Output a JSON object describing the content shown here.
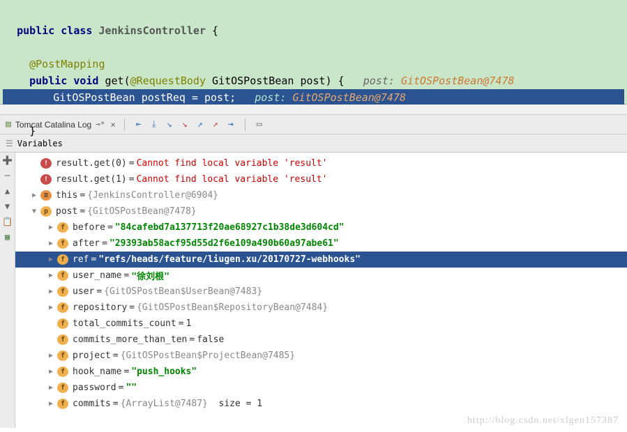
{
  "code": {
    "l1_kw": "public class",
    "l1_name": "JenkinsController",
    "l1_brace": "{",
    "l2_anno": "@PostMapping",
    "l3_kw": "public void",
    "l3_method": "get",
    "l3_anno": "@RequestBody",
    "l3_type": "GitOSPostBean",
    "l3_param": "post",
    "l3_brace": ") {",
    "l3_hint_label": "post:",
    "l3_hint_val": "GitOSPostBean@7478",
    "l4_type": "GitOSPostBean",
    "l4_var": "postReq",
    "l4_eq": "= post;",
    "l4_hint_label": "post:",
    "l4_hint_val": "GitOSPostBean@7478",
    "l5_brace": "}"
  },
  "tabs": {
    "tomcat": "Tomcat Catalina Log"
  },
  "panel_header": "Variables",
  "vars": [
    {
      "icon": "err",
      "name": "result.get(0)",
      "val": "Cannot find local variable 'result'",
      "klass": "v-err-val",
      "lvl": 1,
      "arrow": ""
    },
    {
      "icon": "err",
      "name": "result.get(1)",
      "val": "Cannot find local variable 'result'",
      "klass": "v-err-val",
      "lvl": 1,
      "arrow": ""
    },
    {
      "icon": "obj",
      "name": "this",
      "val": "{JenkinsController@6904}",
      "klass": "v-obj-val",
      "lvl": 1,
      "arrow": "collapsed"
    },
    {
      "icon": "p",
      "name": "post",
      "val": "{GitOSPostBean@7478}",
      "klass": "v-obj-val",
      "lvl": 1,
      "arrow": "expanded"
    },
    {
      "icon": "fld",
      "name": "before",
      "val": "\"84cafebd7a137713f20ae68927c1b38de3d604cd\"",
      "klass": "v-str-val",
      "lvl": 2,
      "arrow": "collapsed"
    },
    {
      "icon": "fld",
      "name": "after",
      "val": "\"29393ab58acf95d55d2f6e109a490b60a97abe61\"",
      "klass": "v-str-val",
      "lvl": 2,
      "arrow": "collapsed"
    },
    {
      "icon": "fld",
      "name": "ref",
      "val": "\"refs/heads/feature/liugen.xu/20170727-webhooks\"",
      "klass": "v-str-val",
      "lvl": 2,
      "arrow": "collapsed",
      "sel": true
    },
    {
      "icon": "fld",
      "name": "user_name",
      "val": "\"徐刘根\"",
      "klass": "v-str-val",
      "lvl": 2,
      "arrow": "collapsed"
    },
    {
      "icon": "fld",
      "name": "user",
      "val": "{GitOSPostBean$UserBean@7483}",
      "klass": "v-obj-val",
      "lvl": 2,
      "arrow": "collapsed"
    },
    {
      "icon": "fld",
      "name": "repository",
      "val": "{GitOSPostBean$RepositoryBean@7484}",
      "klass": "v-obj-val",
      "lvl": 2,
      "arrow": "collapsed"
    },
    {
      "icon": "fld",
      "name": "total_commits_count",
      "val": "1",
      "klass": "v-plain",
      "lvl": 2,
      "arrow": ""
    },
    {
      "icon": "fld",
      "name": "commits_more_than_ten",
      "val": "false",
      "klass": "v-plain",
      "lvl": 2,
      "arrow": ""
    },
    {
      "icon": "fld",
      "name": "project",
      "val": "{GitOSPostBean$ProjectBean@7485}",
      "klass": "v-obj-val",
      "lvl": 2,
      "arrow": "collapsed"
    },
    {
      "icon": "fld",
      "name": "hook_name",
      "val": "\"push_hooks\"",
      "klass": "v-str-val",
      "lvl": 2,
      "arrow": "collapsed"
    },
    {
      "icon": "fld",
      "name": "password",
      "val": "\"\"",
      "klass": "v-str-val",
      "lvl": 2,
      "arrow": "collapsed"
    },
    {
      "icon": "fld",
      "name": "commits",
      "val": "{ArrayList@7487}",
      "klass": "v-obj-val",
      "lvl": 2,
      "arrow": "collapsed",
      "extra_label": "size",
      "extra_val": "1"
    }
  ],
  "watermark": "http://blog.csdn.net/xlgen157387"
}
